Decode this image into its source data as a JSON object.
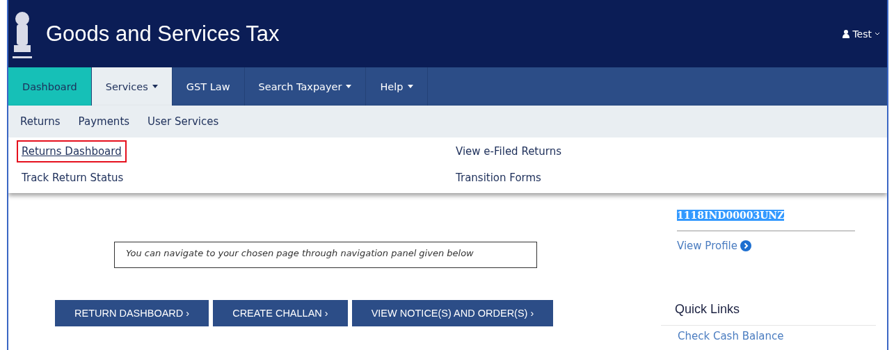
{
  "header": {
    "title": "Goods and Services Tax",
    "user": "Test"
  },
  "nav": [
    {
      "label": "Dashboard",
      "selected": true,
      "expanded": false,
      "has_menu": false
    },
    {
      "label": "Services",
      "selected": false,
      "expanded": true,
      "has_menu": true
    },
    {
      "label": "GST Law",
      "selected": false,
      "expanded": false,
      "has_menu": false
    },
    {
      "label": "Search Taxpayer",
      "selected": false,
      "expanded": false,
      "has_menu": true
    },
    {
      "label": "Help",
      "selected": false,
      "expanded": false,
      "has_menu": true
    }
  ],
  "menu": {
    "categories": [
      "Returns",
      "Payments",
      "User Services"
    ],
    "links": [
      {
        "label": "Returns Dashboard",
        "highlighted": true
      },
      {
        "label": "View e-Filed Returns",
        "highlighted": false
      },
      {
        "label": "Track Return Status",
        "highlighted": false
      },
      {
        "label": "Transition Forms",
        "highlighted": false
      }
    ]
  },
  "notice": "You can navigate to your chosen page through navigation panel given below",
  "buttons": [
    "RETURN DASHBOARD ›",
    "CREATE CHALLAN ›",
    "VIEW NOTICE(S) AND ORDER(S) ›"
  ],
  "profile": {
    "gstin": "1118IND00003UNZ",
    "link": "View Profile"
  },
  "quick_links": {
    "title": "Quick Links",
    "items": [
      "Check Cash Balance"
    ]
  }
}
